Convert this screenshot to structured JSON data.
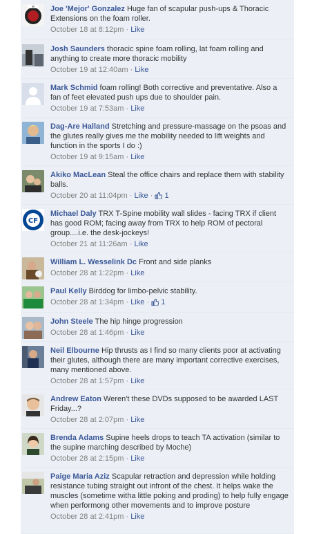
{
  "comments": [
    {
      "author": "Joe 'Mejor' Gonzalez",
      "text": "Huge fan of scapular push-ups & Thoracic Extensions on the foam roller.",
      "time": "October 18 at 8:12pm",
      "like": "Like",
      "likes": "",
      "avatar": "team-logo-avatar"
    },
    {
      "author": "Josh Saunders",
      "text": "thoracic spine foam rolling, lat foam rolling and anything to create more thoracic mobility",
      "time": "October 19 at 12:40am",
      "like": "Like",
      "likes": "",
      "avatar": "photo-avatar"
    },
    {
      "author": "Mark Schmid",
      "text": "foam rolling! Both corrective and preventative. Also a fan of feet elevated push ups due to shoulder pain.",
      "time": "October 19 at 7:53am",
      "like": "Like",
      "likes": "",
      "avatar": "default-silhouette-avatar"
    },
    {
      "author": "Dag-Are Halland",
      "text": "Stretching and pressure-massage on the psoas and the glutes really gives me the mobility needed to lift weights and function in the sports I do :)",
      "time": "October 19 at 9:15am",
      "like": "Like",
      "likes": "",
      "avatar": "photo-avatar"
    },
    {
      "author": "Akiko MacLean",
      "text": "Steal the office chairs and replace them with stability balls.",
      "time": "October 20 at 11:04pm",
      "like": "Like",
      "likes": "1",
      "avatar": "photo-avatar"
    },
    {
      "author": "Michael Daly",
      "text": "TRX T-Spine mobility wall slides - facing TRX if client has good ROM; facing away from TRX to help ROM of pectoral group....i.e. the desk-jockeys!",
      "time": "October 21 at 11:26am",
      "like": "Like",
      "likes": "",
      "avatar": "club-crest-avatar"
    },
    {
      "author": "William L. Wesselink Dc",
      "text": "Front and side planks",
      "time": "October 28 at 1:22pm",
      "like": "Like",
      "likes": "",
      "avatar": "photo-avatar"
    },
    {
      "author": "Paul Kelly",
      "text": "Birddog for limbo-pelvic stability.",
      "time": "October 28 at 1:34pm",
      "like": "Like",
      "likes": "1",
      "avatar": "photo-avatar"
    },
    {
      "author": "John Steele",
      "text": "The hip hinge progression",
      "time": "October 28 at 1:46pm",
      "like": "Like",
      "likes": "",
      "avatar": "photo-avatar"
    },
    {
      "author": "Neil Elbourne",
      "text": "Hip thrusts as I find so many clients poor at activating their glutes, although there are many important corrective exercises, many mentioned above.",
      "time": "October 28 at 1:57pm",
      "like": "Like",
      "likes": "",
      "avatar": "photo-avatar"
    },
    {
      "author": "Andrew Eaton",
      "text": "Weren't these DVDs supposed to be awarded LAST Friday...?",
      "time": "October 28 at 2:07pm",
      "like": "Like",
      "likes": "",
      "avatar": "photo-avatar"
    },
    {
      "author": "Brenda Adams",
      "text": "Supine heels drops to teach TA activation (similar to the supine marching described by Moche)",
      "time": "October 28 at 2:15pm",
      "like": "Like",
      "likes": "",
      "avatar": "photo-avatar"
    },
    {
      "author": "Paige Maria Aziz",
      "text": "Scapular retraction and depression while holding resistance tubing straight out infront of the chest. It helps wake the muscles (sometime witha little poking and proding) to help fully engage when performong other movements and to improve posture",
      "time": "October 28 at 2:41pm",
      "like": "Like",
      "likes": "",
      "avatar": "photo-avatar"
    }
  ],
  "separator": " · ",
  "colors": {
    "link": "#3b5998",
    "thread_bg": "#eceff5",
    "meta": "#808080"
  }
}
